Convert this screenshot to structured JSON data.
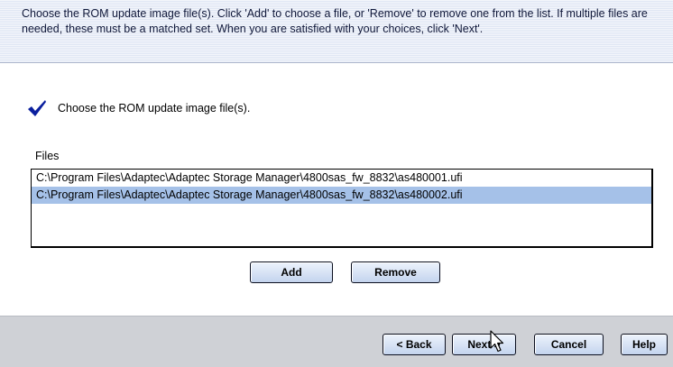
{
  "instructions": {
    "text": "Choose the ROM update image file(s).  Click 'Add' to choose a file, or 'Remove' to remove one from the list.  If multiple files are needed, these must be a matched set.  When you are satisfied with your choices, click 'Next'."
  },
  "status": {
    "icon": "checkmark-icon",
    "text": "Choose the ROM update image file(s)."
  },
  "files": {
    "label": "Files",
    "items": [
      {
        "path": "C:\\Program Files\\Adaptec\\Adaptec Storage Manager\\4800sas_fw_8832\\as480001.ufi",
        "selected": false
      },
      {
        "path": "C:\\Program Files\\Adaptec\\Adaptec Storage Manager\\4800sas_fw_8832\\as480002.ufi",
        "selected": true
      }
    ],
    "add_label": "Add",
    "remove_label": "Remove"
  },
  "nav": {
    "back_label": "< Back",
    "next_label": "Next >",
    "cancel_label": "Cancel",
    "help_label": "Help"
  },
  "colors": {
    "selection": "#a5c1e8",
    "button": "#c4d4ee",
    "header_band": "#e7ecf7",
    "footer": "#cfd1d6"
  }
}
